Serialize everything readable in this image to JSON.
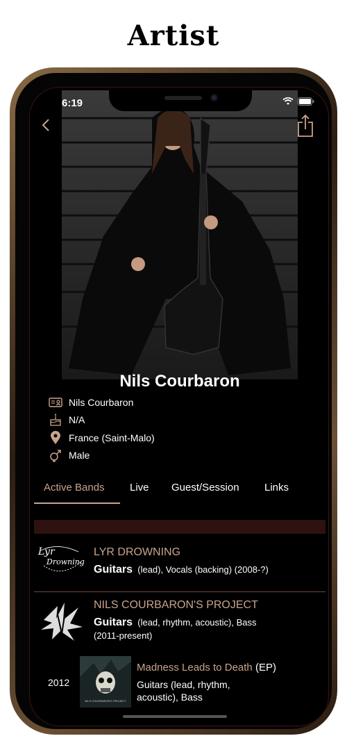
{
  "header": {
    "title": "Artist"
  },
  "status_bar": {
    "time": "6:19"
  },
  "artist": {
    "name": "Nils Courbaron",
    "info": [
      {
        "icon": "id-card-icon",
        "text": "Nils Courbaron"
      },
      {
        "icon": "birthday-cake-icon",
        "text": "N/A"
      },
      {
        "icon": "location-pin-icon",
        "text": "France (Saint-Malo)"
      },
      {
        "icon": "gender-icon",
        "text": "Male"
      }
    ]
  },
  "tabs": [
    {
      "label": "Active Bands",
      "active": true
    },
    {
      "label": "Live"
    },
    {
      "label": "Guest/Session"
    },
    {
      "label": "Links"
    }
  ],
  "bands": [
    {
      "name": "LYR DROWNING",
      "logo_text_1": "Lyr",
      "logo_text_2": "Drowning",
      "role_main": "Guitars",
      "role_rest": "(lead), Vocals (backing) (2008-?)"
    },
    {
      "name": "NILS COURBARON'S PROJECT",
      "role_main": "Guitars",
      "role_rest": "(lead, rhythm, acoustic), Bass",
      "role_years": "(2011-present)",
      "release": {
        "year": "2012",
        "title": "Madness Leads to Death",
        "type": "(EP)",
        "role": "Guitars (lead, rhythm, acoustic), Bass",
        "cover_text": "NILS COURBARON'S PROJECT"
      }
    }
  ],
  "colors": {
    "accent": "#c9a48c",
    "section_bar": "#2e1210",
    "background": "#000000"
  }
}
